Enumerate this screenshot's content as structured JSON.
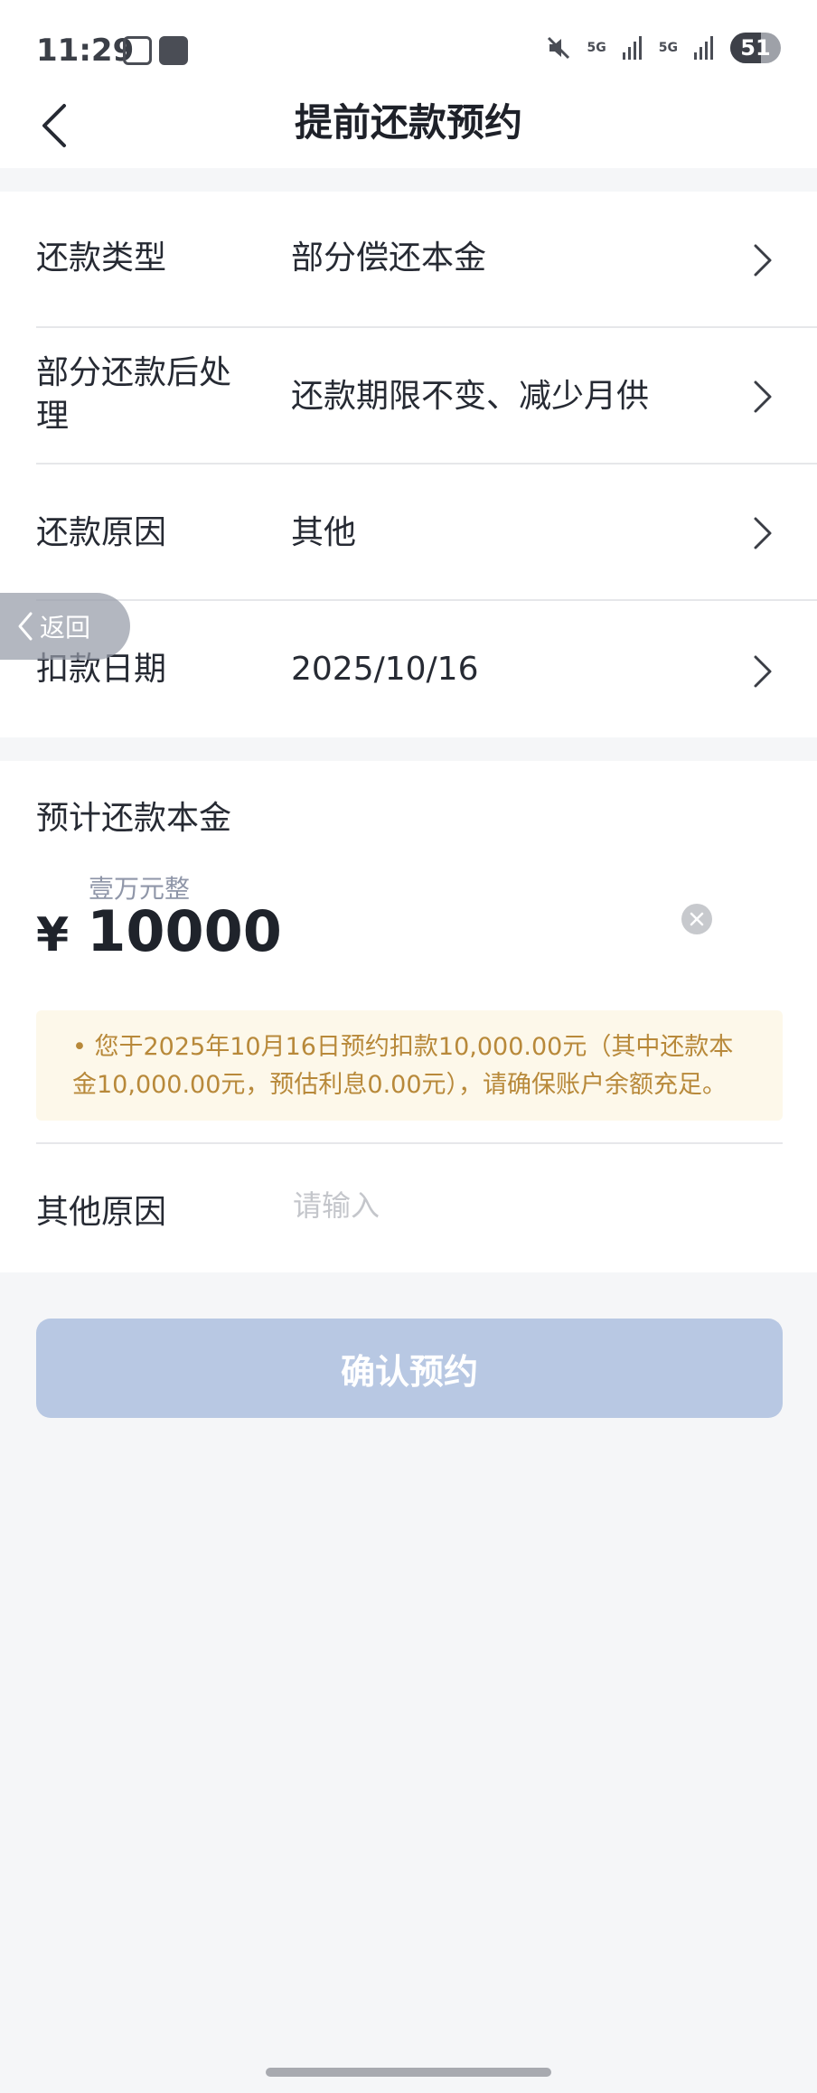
{
  "status_bar": {
    "time": "11:29",
    "network1": "5G",
    "network2": "5G",
    "battery": "51"
  },
  "nav": {
    "title": "提前还款预约"
  },
  "form_rows": [
    {
      "label": "还款类型",
      "value": "部分偿还本金"
    },
    {
      "label_line1": "部分还款后处",
      "label_line2": "理",
      "value": "还款期限不变、减少月供"
    },
    {
      "label": "还款原因",
      "value": "其他"
    },
    {
      "label": "扣款日期",
      "value": "2025/10/16"
    }
  ],
  "float_back": {
    "label": "返回"
  },
  "amount": {
    "label": "预计还款本金",
    "words": "壹万元整",
    "currency": "¥",
    "value": "10000"
  },
  "notice": {
    "text": "• 您于2025年10月16日预约扣款10,000.00元（其中还款本金10,000.00元，预估利息0.00元），请确保账户余额充足。"
  },
  "other_reason": {
    "label": "其他原因",
    "placeholder": "请输入",
    "value": ""
  },
  "confirm_button": {
    "label": "确认预约"
  },
  "colors": {
    "accent_disabled": "#b8c8e3",
    "notice_bg": "#fdf8ea",
    "notice_text": "#b8893a"
  }
}
